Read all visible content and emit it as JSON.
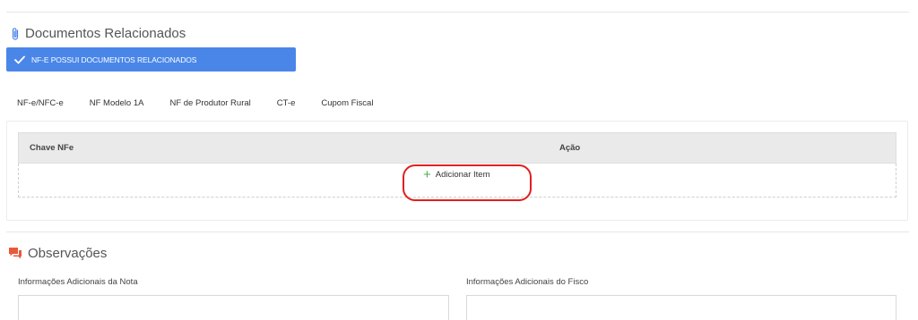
{
  "documentos": {
    "title": "Documentos Relacionados",
    "toggle_label": "NF-E POSSUI DOCUMENTOS RELACIONADOS",
    "tabs": [
      "NF-e/NFC-e",
      "NF Modelo 1A",
      "NF de Produtor Rural",
      "CT-e",
      "Cupom Fiscal"
    ],
    "table": {
      "headers": {
        "chave": "Chave NFe",
        "acao": "Ação"
      },
      "add_item_label": "Adicionar Item"
    }
  },
  "observacoes": {
    "title": "Observações",
    "fields": {
      "nota_label": "Informações Adicionais da Nota",
      "fisco_label": "Informações Adicionais do Fisco",
      "nota_value": "",
      "fisco_value": ""
    }
  },
  "colors": {
    "accent": "#4a86e8",
    "observacoes_icon": "#e8593b",
    "add_icon": "#4caf50",
    "highlight": "#e0201e"
  },
  "icons": {
    "documentos": "paperclip-icon",
    "toggle": "check-icon",
    "observacoes": "chat-bubbles-icon",
    "add": "plus-icon"
  }
}
